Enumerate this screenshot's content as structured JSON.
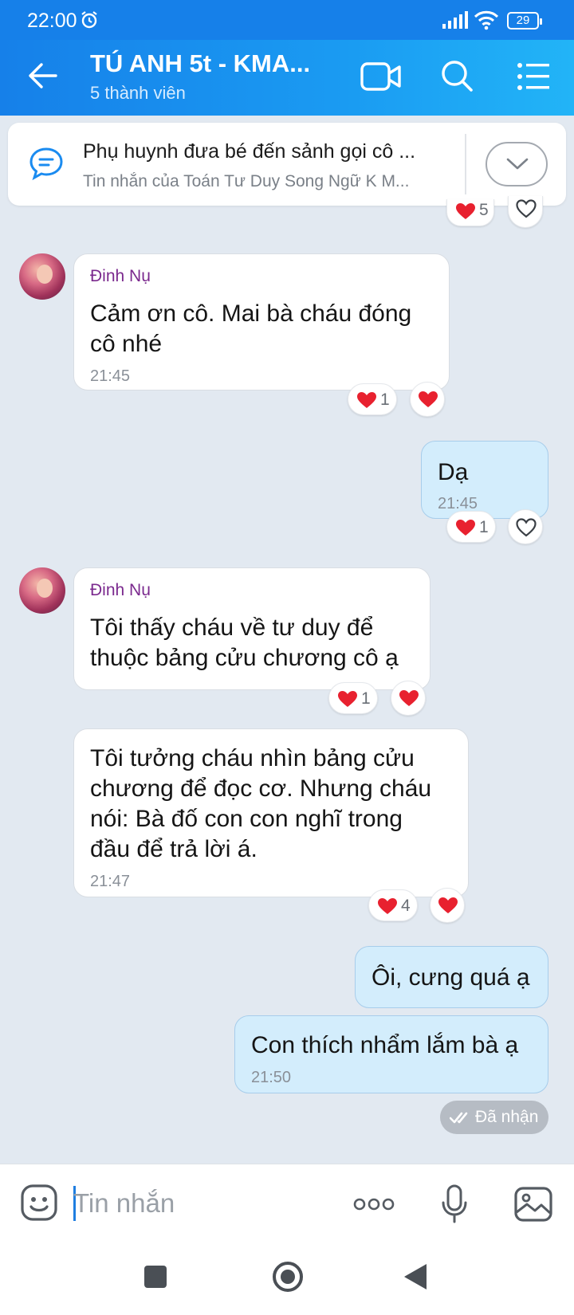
{
  "status_bar": {
    "time": "22:00",
    "battery": "29"
  },
  "header": {
    "title": "TÚ ANH 5t - KMA...",
    "subtitle": "5 thành viên"
  },
  "pinned": {
    "title": "Phụ huynh đưa bé đến sảnh gọi cô ...",
    "subtitle": "Tin nhắn của Toán Tư Duy Song Ngữ K M..."
  },
  "messages": [
    {
      "sender": "Đinh Nụ",
      "text": "Cảm ơn cô. Mai bà cháu đóng\ncô nhé",
      "time": "21:45",
      "reaction_count": "1"
    },
    {
      "text": "Dạ",
      "time": "21:45",
      "reaction_count": "1"
    },
    {
      "sender": "Đinh Nụ",
      "text": "Tôi thấy cháu về tư duy để\nthuộc bảng cửu chương cô ạ",
      "reaction_count": "1"
    },
    {
      "text": "Tôi tưởng cháu nhìn bảng cửu\nchương để đọc cơ. Nhưng cháu\nnói: Bà đố con con nghĩ trong\nđầu để trả lời á.",
      "time": "21:47",
      "reaction_count": "4"
    },
    {
      "text": "Ôi, cưng quá ạ"
    },
    {
      "text": "Con thích nhẩm lắm bà ạ",
      "time": "21:50"
    }
  ],
  "top_reaction_count": "5",
  "delivered_label": "Đã nhận",
  "input": {
    "placeholder": "Tin nhắn"
  },
  "colors": {
    "header_blue": "#1680e9",
    "outgoing_bubble": "#d3edfc",
    "sender_name": "#7b2a8e",
    "heart_red": "#e8212f"
  }
}
